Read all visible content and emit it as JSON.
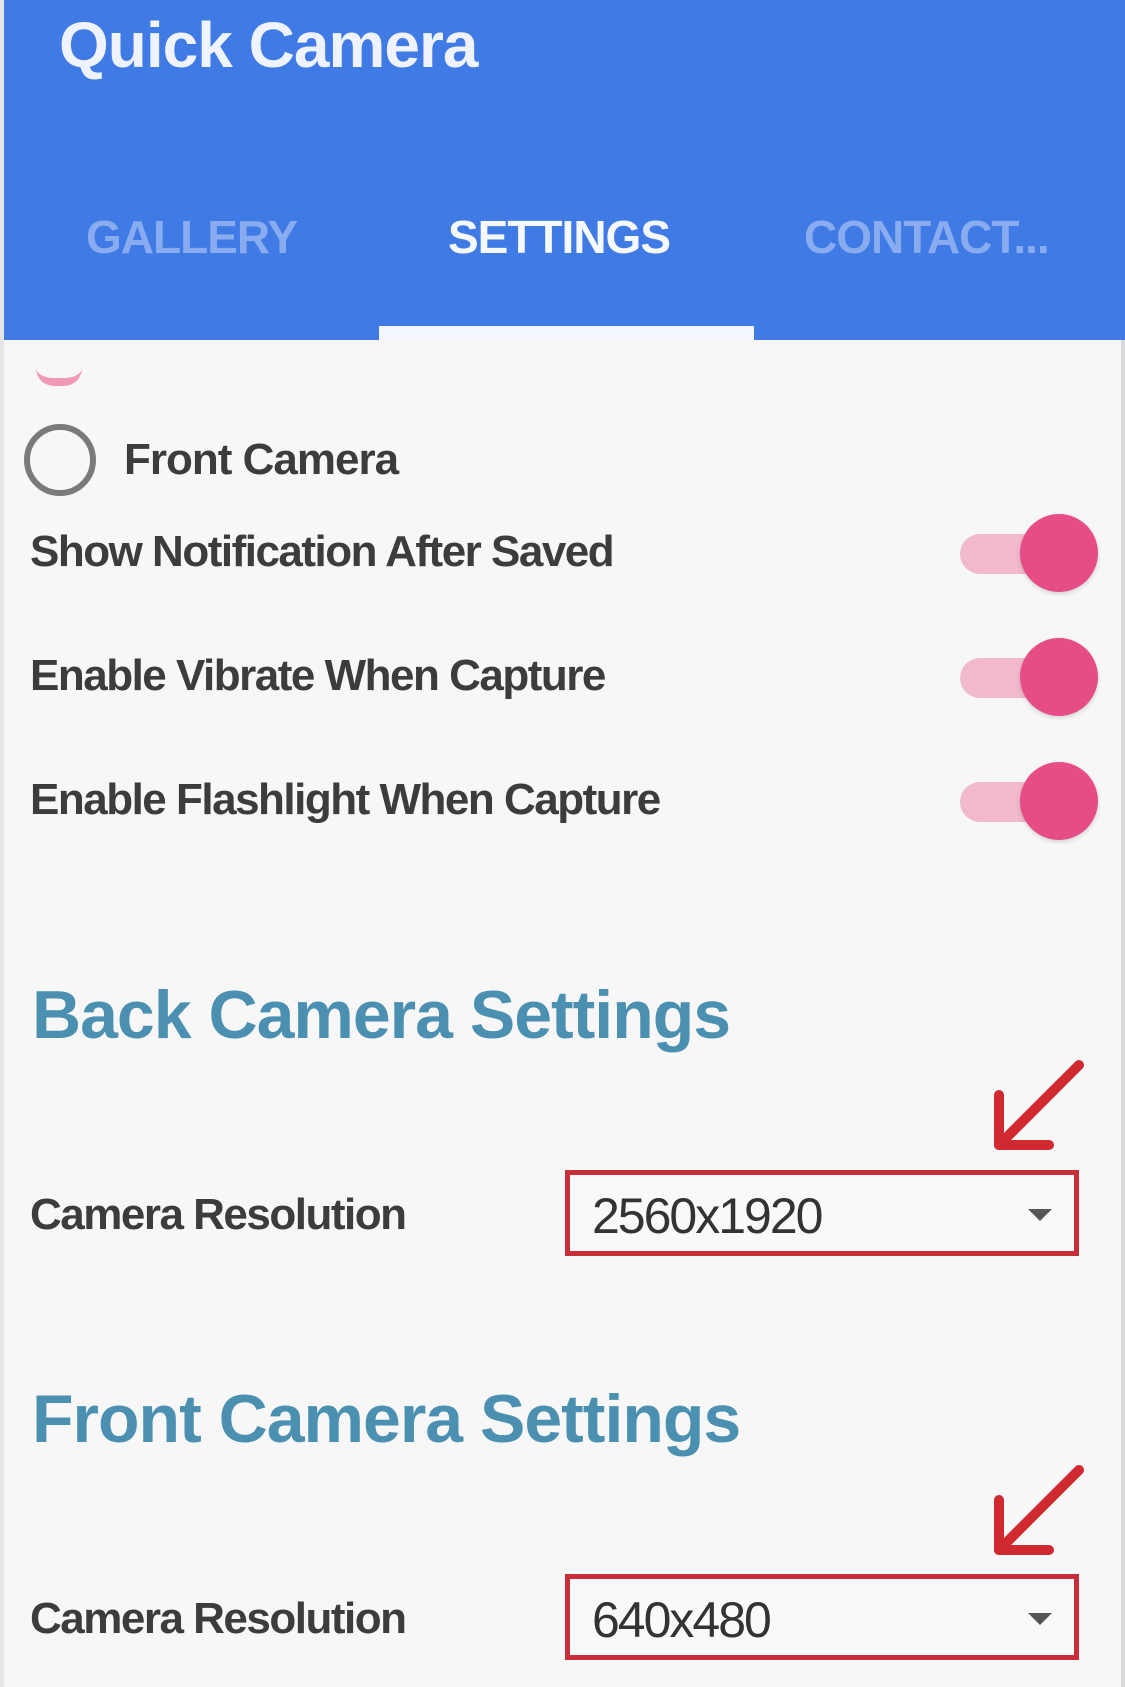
{
  "app": {
    "title": "Quick Camera"
  },
  "tabs": [
    {
      "label": "GALLERY",
      "active": false
    },
    {
      "label": "SETTINGS",
      "active": true
    },
    {
      "label": "CONTACT...",
      "active": false
    }
  ],
  "settings": {
    "front_camera_option": {
      "label": "Front Camera",
      "selected": false
    },
    "toggles": [
      {
        "label": "Show Notification After Saved",
        "on": true
      },
      {
        "label": "Enable Vibrate When Capture",
        "on": true
      },
      {
        "label": "Enable Flashlight When Capture",
        "on": true
      }
    ],
    "back_camera": {
      "heading": "Back Camera Settings",
      "resolution_label": "Camera Resolution",
      "resolution_value": "2560x1920"
    },
    "front_camera": {
      "heading": "Front Camera Settings",
      "resolution_label": "Camera Resolution",
      "resolution_value": "640x480"
    }
  },
  "colors": {
    "appbar": "#3f7ae5",
    "accent": "#e64d86",
    "section_heading": "#4b90b0",
    "annotation": "#c62f3a"
  },
  "icons": [
    "radio-unchecked-icon",
    "dropdown-caret-icon",
    "annotation-arrow-icon"
  ]
}
